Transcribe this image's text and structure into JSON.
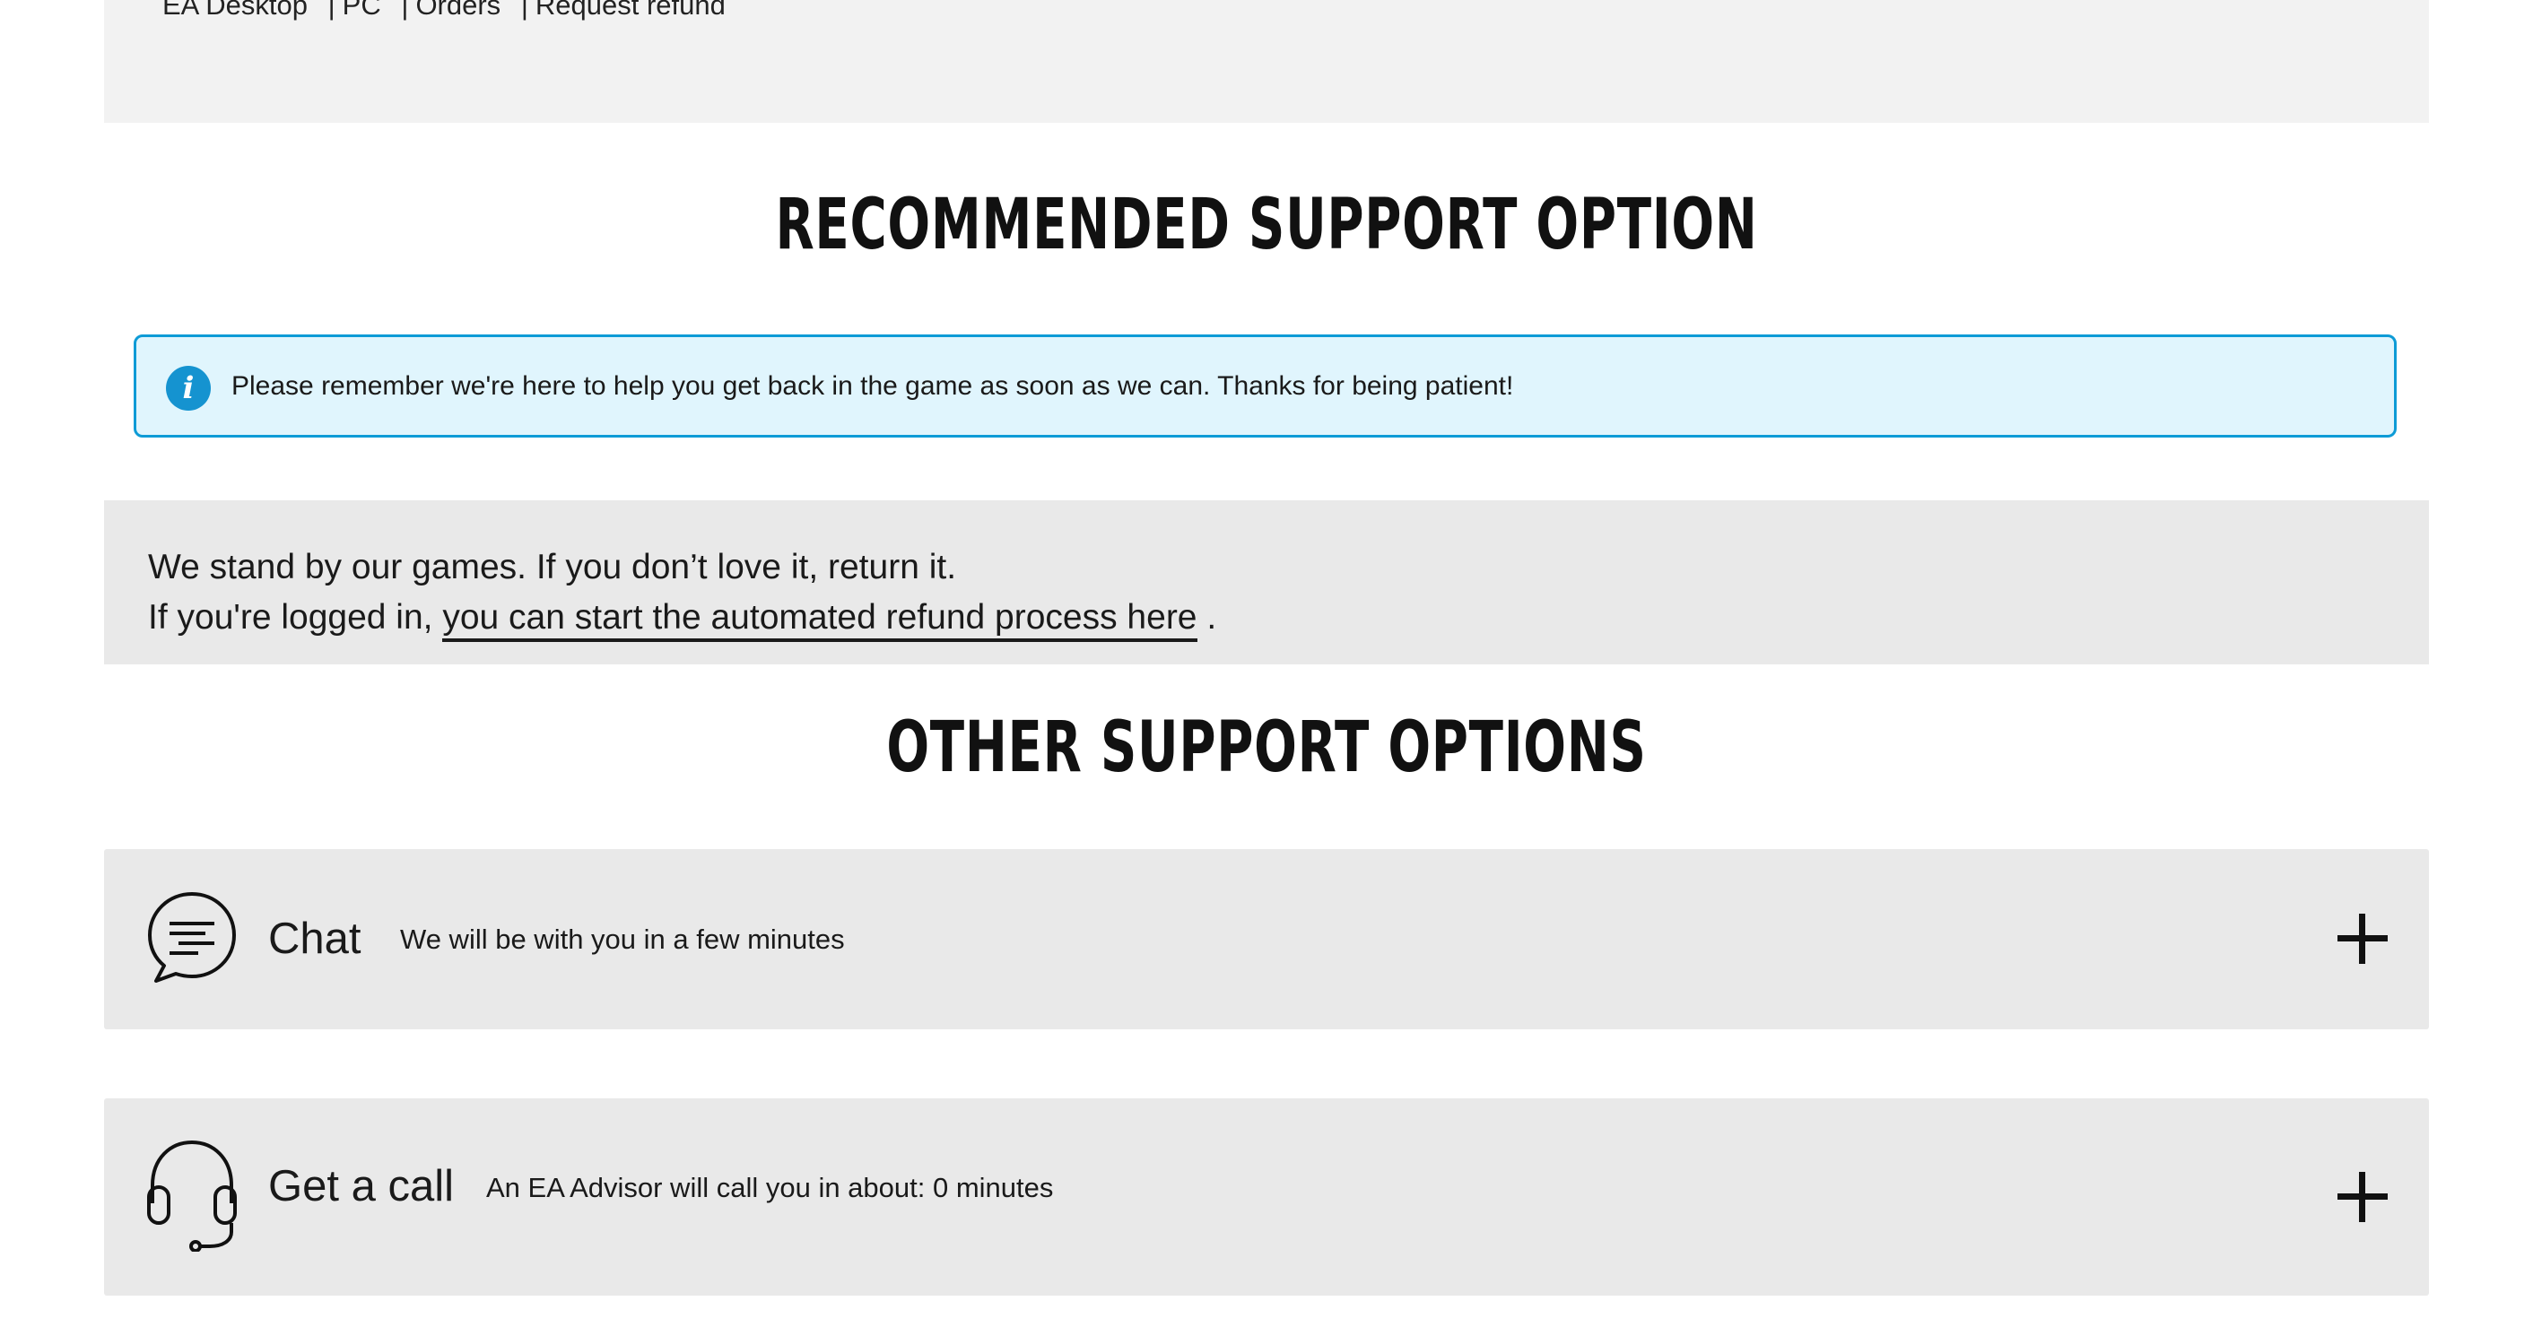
{
  "breadcrumb": {
    "items": [
      "EA Desktop",
      "PC",
      "Orders",
      "Request refund"
    ],
    "separator": "|"
  },
  "recommended": {
    "heading": "RECOMMENDED SUPPORT OPTION",
    "banner": {
      "icon": "info-icon",
      "icon_glyph": "i",
      "text": "Please remember we're here to help you get back in the game as soon as we can. Thanks for being patient!",
      "accent_color": "#0d9bd6",
      "background_color": "#e0f5fd"
    },
    "refund": {
      "line1": "We stand by our games. If you don’t love it, return it.",
      "line2_prefix": "If you're logged in, ",
      "link_text": "you can start the automated refund process here",
      "line2_suffix": " ."
    }
  },
  "other": {
    "heading": "OTHER SUPPORT OPTIONS",
    "options": [
      {
        "icon": "chat-bubble-icon",
        "title": "Chat",
        "description": "We will be with you in a few minutes",
        "expand_icon": "plus-icon"
      },
      {
        "icon": "headset-icon",
        "title": "Get a call",
        "description": "An EA Advisor will call you in about: 0 minutes",
        "expand_icon": "plus-icon"
      }
    ]
  }
}
